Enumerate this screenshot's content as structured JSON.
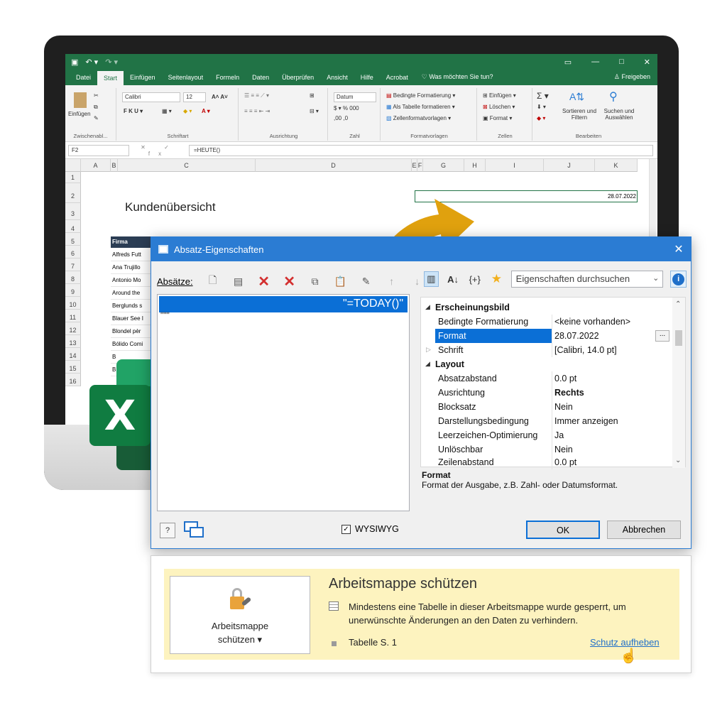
{
  "excel": {
    "tabs": [
      "Datei",
      "Start",
      "Einfügen",
      "Seitenlayout",
      "Formeln",
      "Daten",
      "Überprüfen",
      "Ansicht",
      "Hilfe",
      "Acrobat"
    ],
    "active_tab": "Start",
    "tell_me": "Was möchten Sie tun?",
    "share": "Freigeben",
    "ribbon": {
      "paste": "Einfügen",
      "clipboard_group": "Zwischenabl...",
      "font_name": "Calibri",
      "font_size": "12",
      "font_group": "Schriftart",
      "align_group": "Ausrichtung",
      "number_format": "Datum",
      "number_group": "Zahl",
      "cond_format": "Bedingte Formatierung",
      "as_table": "Als Tabelle formatieren",
      "cell_styles": "Zellenformatvorlagen",
      "styles_group": "Formatvorlagen",
      "insert": "Einfügen",
      "delete": "Löschen",
      "format": "Format",
      "cells_group": "Zellen",
      "sort_filter": "Sortieren und Filtern",
      "find_select": "Suchen und Auswählen",
      "edit_group": "Bearbeiten"
    },
    "name_box": "F2",
    "formula": "=HEUTE()",
    "columns": [
      "A",
      "B",
      "C",
      "D",
      "E",
      "F",
      "G",
      "H",
      "I",
      "J",
      "K"
    ],
    "rows": [
      "1",
      "2",
      "3",
      "4",
      "5",
      "6",
      "7",
      "8",
      "9",
      "10",
      "11",
      "12",
      "13",
      "14",
      "15",
      "16"
    ],
    "sheet_title": "Kundenübersicht",
    "date_cell": "28.07.2022",
    "firma_header": "Firma",
    "firma_values": [
      "Alfreds Futt",
      "Ana Trujillo",
      "Antonio Mo",
      "Around the",
      "Berglunds s",
      "Blauer See I",
      "Blondel pèr",
      "Bólido Comi",
      "B",
      "B"
    ]
  },
  "dialog": {
    "title": "Absatz-Eigenschaften",
    "paragraphs_label": "Absätze:",
    "paragraph_value": "\"=TODAY()\"",
    "quotes_line": "\"\"\"",
    "search_placeholder": "Eigenschaften durchsuchen",
    "properties": [
      {
        "type": "category",
        "name": "Erscheinungsbild"
      },
      {
        "type": "prop",
        "name": "Bedingte Formatierung",
        "value": "<keine vorhanden>"
      },
      {
        "type": "selected",
        "name": "Format",
        "value": "28.07.2022"
      },
      {
        "type": "collapsed",
        "name": "Schrift",
        "value": "[Calibri, 14.0 pt]"
      },
      {
        "type": "category",
        "name": "Layout"
      },
      {
        "type": "prop",
        "name": "Absatzabstand",
        "value": "0.0 pt"
      },
      {
        "type": "prop",
        "name": "Ausrichtung",
        "value": "Rechts",
        "bold": true
      },
      {
        "type": "prop",
        "name": "Blocksatz",
        "value": "Nein"
      },
      {
        "type": "prop",
        "name": "Darstellungsbedingung",
        "value": "Immer anzeigen"
      },
      {
        "type": "prop",
        "name": "Leerzeichen-Optimierung",
        "value": "Ja"
      },
      {
        "type": "prop",
        "name": "Unlöschbar",
        "value": "Nein"
      },
      {
        "type": "prop",
        "name": "Zeilenabstand",
        "value": "0.0 pt"
      }
    ],
    "desc_title": "Format",
    "desc_text": "Format der Ausgabe, z.B. Zahl- oder Datumsformat.",
    "wysiwyg": "WYSIWYG",
    "ok": "OK",
    "cancel": "Abbrechen"
  },
  "protect": {
    "button_line1": "Arbeitsmappe",
    "button_line2": "schützen ▾",
    "title": "Arbeitsmappe schützen",
    "message": "Mindestens eine Tabelle in dieser Arbeitsmappe wurde gesperrt, um unerwünschte Änderungen an den Daten zu verhindern.",
    "sheet": "Tabelle S. 1",
    "unprotect_link": "Schutz aufheben"
  },
  "colors": {
    "excel_green": "#217346",
    "dialog_blue": "#2b7cd3",
    "selection_blue": "#0b6fd6",
    "arrow_gold": "#e0a10e",
    "panel_yellow": "#fdf3bf"
  }
}
